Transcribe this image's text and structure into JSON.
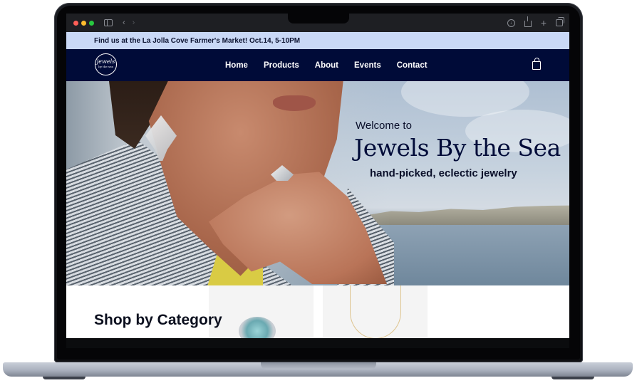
{
  "announcement": {
    "text": "Find us at the La Jolla Cove Farmer's Market! Oct.14, 5-10PM"
  },
  "header": {
    "logo": {
      "main": "jewels",
      "sub": "by the sea"
    },
    "nav": [
      "Home",
      "Products",
      "About",
      "Events",
      "Contact"
    ],
    "cart_icon": "shopping-bag-icon"
  },
  "hero": {
    "welcome": "Welcome to",
    "brand": "Jewels By the Sea",
    "tagline": "hand-picked, eclectic jewelry"
  },
  "categories": {
    "title": "Shop by Category"
  },
  "colors": {
    "announcement_bg": "#c9d8f6",
    "header_bg": "#000b38",
    "brand_text": "#000b38"
  },
  "browser": {
    "icons": [
      "close-dot",
      "minimize-dot",
      "zoom-dot",
      "sidebar-icon",
      "back-icon",
      "forward-icon",
      "download-icon",
      "share-icon",
      "new-tab-icon",
      "tabs-overview-icon"
    ]
  }
}
